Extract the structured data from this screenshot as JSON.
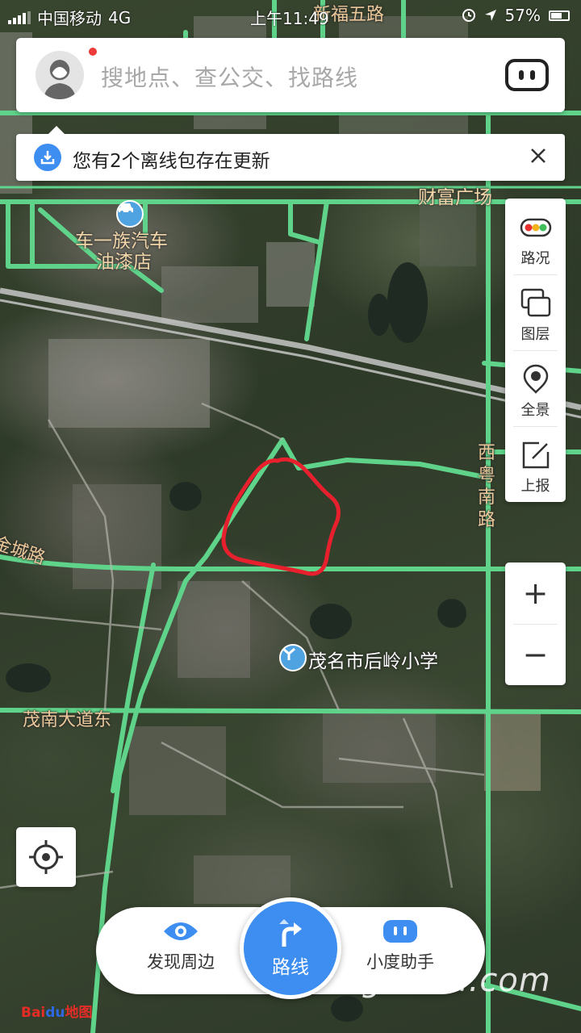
{
  "status_bar": {
    "carrier": "中国移动",
    "network": "4G",
    "time": "上午11:49",
    "battery": "57%"
  },
  "search": {
    "placeholder": "搜地点、查公交、找路线",
    "avatar_icon": "user-avatar",
    "assistant_icon": "xiaodu-assistant-icon"
  },
  "notice": {
    "text": "您有2个离线包存在更新",
    "icon": "download-icon"
  },
  "map": {
    "roads": [
      "金城路",
      "茂南大道东",
      "西粤南路",
      "新福五路"
    ],
    "pois": {
      "car_shop_line1": "车一族汽车",
      "car_shop_line2": "油漆店",
      "plaza": "财富广场",
      "school": "茂名市后岭小学"
    },
    "colors": {
      "road": "#5fd38a",
      "highlight_circle": "#e8202e"
    }
  },
  "tools": [
    {
      "label": "路况",
      "icon": "traffic-light-icon"
    },
    {
      "label": "图层",
      "icon": "layers-icon"
    },
    {
      "label": "全景",
      "icon": "panorama-pin-icon"
    },
    {
      "label": "上报",
      "icon": "report-edit-icon"
    }
  ],
  "zoom": {
    "in": "+",
    "out": "−"
  },
  "bottom": {
    "discover": "发现周边",
    "route": "路线",
    "assistant": "小度助手"
  },
  "branding": {
    "watermark": "gdmm.com",
    "logo_bai": "Bai",
    "logo_du": "du",
    "logo_map": "地图"
  },
  "accent_color": "#3d8ef0"
}
